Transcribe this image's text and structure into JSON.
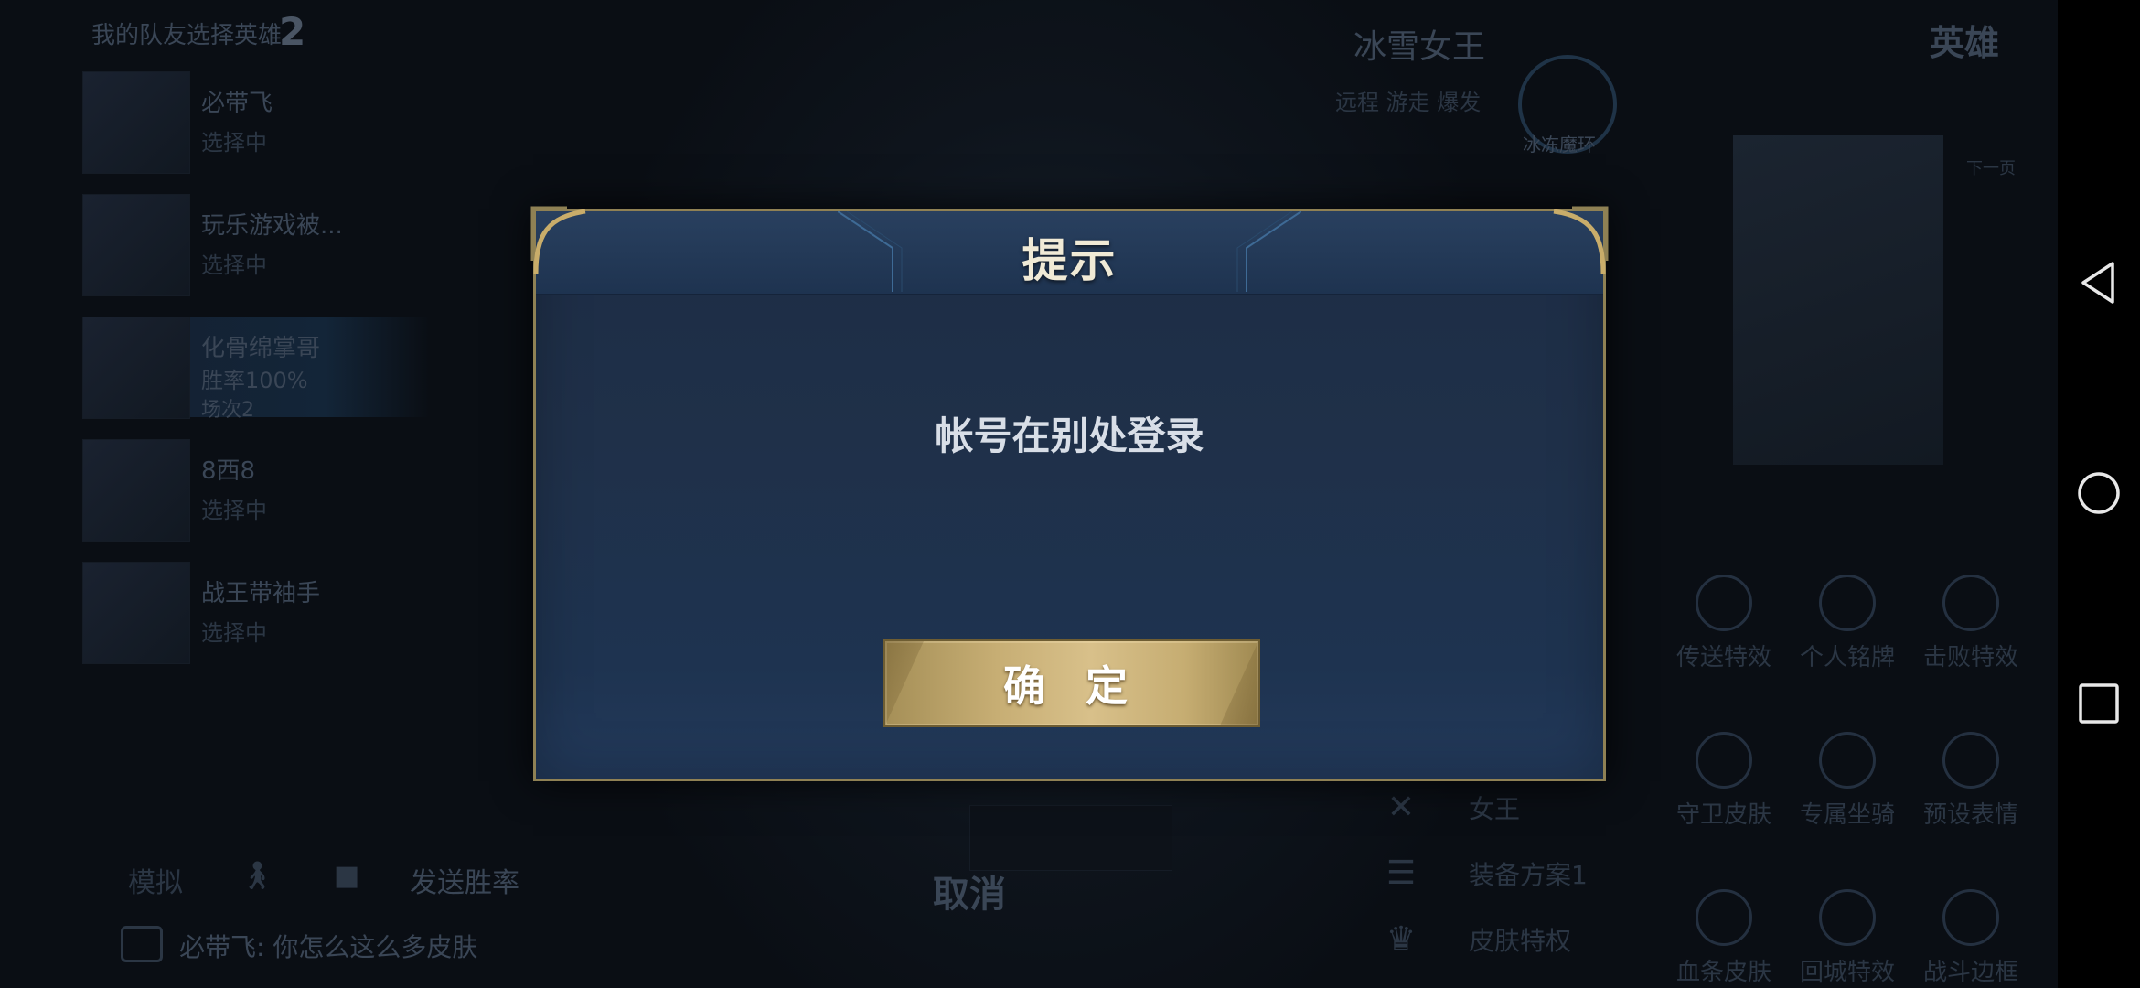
{
  "background": {
    "team_title": "我的队友选择英雄",
    "team_count": "2",
    "players": [
      {
        "name": "必带飞",
        "sub": "选择中"
      },
      {
        "name": "玩乐游戏被...",
        "sub": "选择中"
      },
      {
        "name": "化骨绵掌哥",
        "sub": "胜率100%",
        "sub2": "场次2"
      },
      {
        "name": "8西8",
        "sub": "选择中"
      },
      {
        "name": "战王带袖手",
        "sub": "选择中"
      }
    ],
    "bottom_bar": [
      "模拟",
      "",
      "",
      "发送胜率"
    ],
    "chat_line": "必带飞: 你怎么这么多皮肤",
    "hero_name": "冰雪女王",
    "hero_tags": "远程 游走 爆发",
    "hero_badge": "冰冻魔环",
    "top_right_title": "英雄",
    "skin_tag": "下一页",
    "cancel_label": "取消",
    "right_panel_rows": [
      "女王",
      "装备方案1",
      "皮肤特权"
    ],
    "grid_items": [
      "传送特效",
      "个人铭牌",
      "击败特效",
      "守卫皮肤",
      "专属坐骑",
      "预设表情",
      "血条皮肤",
      "回城特效",
      "战斗边框"
    ]
  },
  "dialog": {
    "title": "提示",
    "message": "帐号在别处登录",
    "confirm_label": "确 定"
  },
  "colors": {
    "dialog_bg": "#1f3049",
    "gold_border": "#8f8154",
    "button_gold": "#c7ae74"
  },
  "navbar": {
    "icons": [
      "back-icon",
      "home-icon",
      "recents-icon"
    ]
  }
}
